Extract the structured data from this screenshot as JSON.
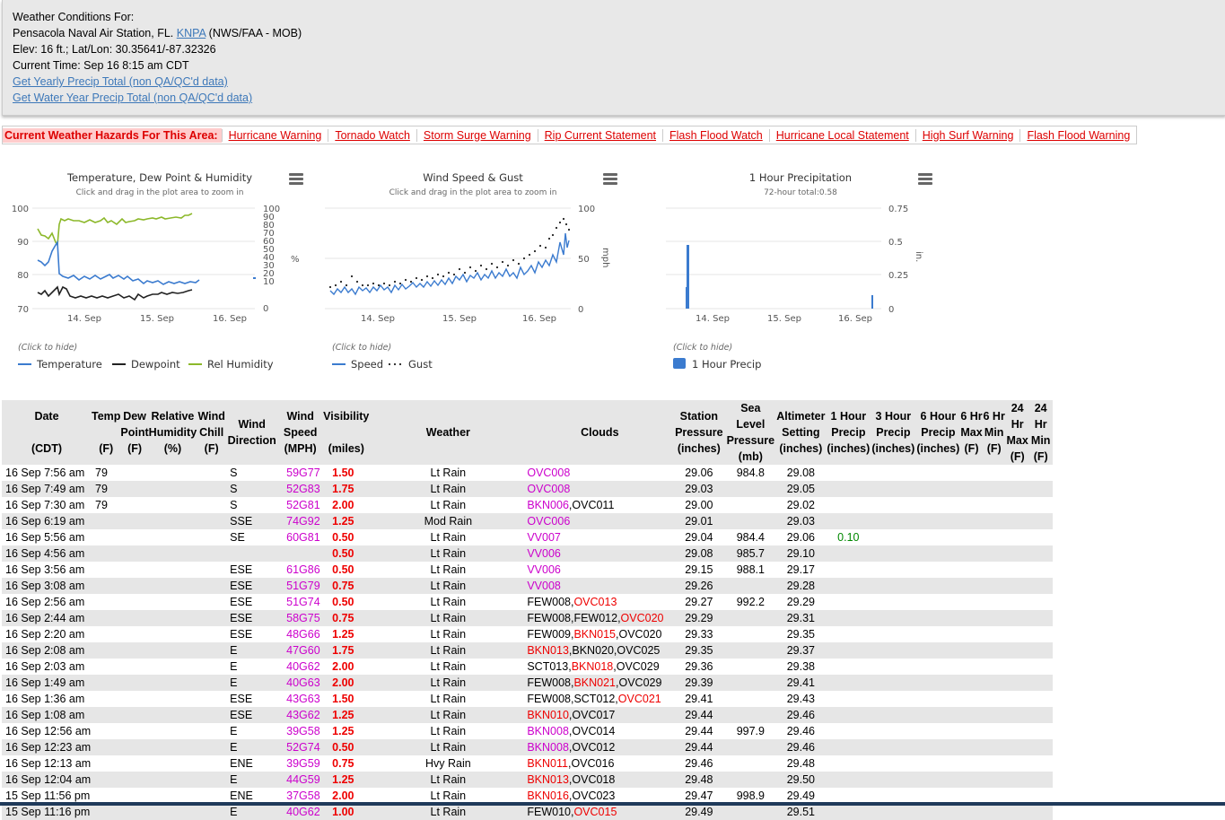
{
  "header": {
    "line1": "Weather Conditions For:",
    "station_prefix": "Pensacola Naval Air Station, FL.",
    "station_link": "KNPA",
    "station_suffix": "(NWS/FAA   - MOB)",
    "elev": "Elev: 16 ft.; Lat/Lon: 30.35641/-87.32326",
    "current_time": "Current Time: Sep 16 8:15 am CDT",
    "link_yearly": "Get Yearly Precip Total (non QA/QC'd data)",
    "link_water": "Get Water Year Precip Total (non QA/QC'd data)"
  },
  "hazards": {
    "label": "Current Weather Hazards For This Area:",
    "items": [
      "Hurricane Warning",
      "Tornado Watch",
      "Storm Surge Warning",
      "Rip Current Statement",
      "Flash Flood Watch",
      "Hurricane Local Statement",
      "High Surf Warning",
      "Flash Flood Warning"
    ]
  },
  "charts": {
    "temp": {
      "title": "Temperature, Dew Point & Humidity",
      "subtitle": "Click and drag in the plot area to zoom in",
      "hide": "(Click to hide)",
      "legend": [
        "Temperature",
        "Dewpoint",
        "Rel Humidity"
      ],
      "colors": [
        "#3b7bcf",
        "#222222",
        "#8cb82a"
      ],
      "yleft": [
        "100",
        "90",
        "80",
        "70"
      ],
      "yright": [
        "100",
        "90",
        "80",
        "70",
        "60",
        "50",
        "40",
        "30",
        "20",
        "10",
        "0"
      ],
      "yright_unit": "%",
      "xticks": [
        "14. Sep",
        "15. Sep",
        "16. Sep"
      ]
    },
    "wind": {
      "title": "Wind Speed & Gust",
      "subtitle": "Click and drag in the plot area to zoom in",
      "hide": "(Click to hide)",
      "legend": [
        "Speed",
        "Gust"
      ],
      "yright": [
        "100",
        "50",
        "0"
      ],
      "yunit": "mph",
      "xticks": [
        "14. Sep",
        "15. Sep",
        "16. Sep"
      ]
    },
    "precip": {
      "title": "1 Hour Precipitation",
      "subtitle": "72-hour total:0.58",
      "hide": "(Click to hide)",
      "legend": [
        "1 Hour Precip"
      ],
      "yright": [
        "0.75",
        "0.5",
        "0.25",
        "0"
      ],
      "yunit": "in.",
      "xticks": [
        "14. Sep",
        "15. Sep",
        "16. Sep"
      ]
    }
  },
  "table": {
    "headers": {
      "date": [
        "Date",
        "",
        "(CDT)"
      ],
      "temp": [
        "Temp",
        "",
        "(F)"
      ],
      "dew": [
        "Dew",
        "Point",
        "(F)"
      ],
      "rh": [
        "Relative",
        "Humidity",
        "(%)"
      ],
      "chill": [
        "Wind",
        "Chill",
        "(F)"
      ],
      "wdir": [
        "Wind",
        "Direction"
      ],
      "wspd": [
        "Wind",
        "Speed",
        "(MPH)"
      ],
      "vis": [
        "Visibility",
        "",
        "(miles)"
      ],
      "wx": [
        "Weather"
      ],
      "clouds": [
        "Clouds"
      ],
      "stp": [
        "Station",
        "Pressure",
        "(inches)"
      ],
      "slp": [
        "Sea Level",
        "Pressure",
        "(mb)"
      ],
      "alt": [
        "Altimeter",
        "Setting",
        "(inches)"
      ],
      "p1": [
        "1 Hour",
        "Precip",
        "(inches)"
      ],
      "p3": [
        "3 Hour",
        "Precip",
        "(inches)"
      ],
      "p6": [
        "6 Hour",
        "Precip",
        "(inches)"
      ],
      "max6": [
        "6 Hr",
        "Max",
        "(F)"
      ],
      "min6": [
        "6 Hr",
        "Min",
        "(F)"
      ],
      "max24": [
        "24 Hr",
        "Max",
        "(F)"
      ],
      "min24": [
        "24 Hr",
        "Min",
        "(F)"
      ]
    },
    "rows": [
      {
        "date": "16 Sep 7:56 am",
        "temp": "79",
        "dir": "S",
        "wind": "59G77",
        "vis": "1.50",
        "wx": "Lt Rain",
        "clouds": [
          [
            "OVC008",
            "m"
          ]
        ],
        "stp": "29.06",
        "slp": "984.8",
        "alt": "29.08",
        "p1": ""
      },
      {
        "date": "16 Sep 7:49 am",
        "temp": "79",
        "dir": "S",
        "wind": "52G83",
        "vis": "1.75",
        "wx": "Lt Rain",
        "clouds": [
          [
            "OVC008",
            "m"
          ]
        ],
        "stp": "29.03",
        "slp": "",
        "alt": "29.05",
        "p1": ""
      },
      {
        "date": "16 Sep 7:30 am",
        "temp": "79",
        "dir": "S",
        "wind": "52G81",
        "vis": "2.00",
        "wx": "Lt Rain",
        "clouds": [
          [
            "BKN006",
            "m"
          ],
          [
            ",OVC011",
            "k"
          ]
        ],
        "stp": "29.00",
        "slp": "",
        "alt": "29.02",
        "p1": ""
      },
      {
        "date": "16 Sep 6:19 am",
        "temp": "",
        "dir": "SSE",
        "wind": "74G92",
        "vis": "1.25",
        "wx": "Mod Rain",
        "clouds": [
          [
            "OVC006",
            "m"
          ]
        ],
        "stp": "29.01",
        "slp": "",
        "alt": "29.03",
        "p1": ""
      },
      {
        "date": "16 Sep 5:56 am",
        "temp": "",
        "dir": "SE",
        "wind": "60G81",
        "vis": "0.50",
        "wx": "Lt Rain",
        "clouds": [
          [
            "VV007",
            "m"
          ]
        ],
        "stp": "29.04",
        "slp": "984.4",
        "alt": "29.06",
        "p1": "0.10"
      },
      {
        "date": "16 Sep 4:56 am",
        "temp": "",
        "dir": "",
        "wind": "",
        "vis": "0.50",
        "wx": "Lt Rain",
        "clouds": [
          [
            "VV006",
            "m"
          ]
        ],
        "stp": "29.08",
        "slp": "985.7",
        "alt": "29.10",
        "p1": ""
      },
      {
        "date": "16 Sep 3:56 am",
        "temp": "",
        "dir": "ESE",
        "wind": "61G86",
        "vis": "0.50",
        "wx": "Lt Rain",
        "clouds": [
          [
            "VV006",
            "m"
          ]
        ],
        "stp": "29.15",
        "slp": "988.1",
        "alt": "29.17",
        "p1": ""
      },
      {
        "date": "16 Sep 3:08 am",
        "temp": "",
        "dir": "ESE",
        "wind": "51G79",
        "vis": "0.75",
        "wx": "Lt Rain",
        "clouds": [
          [
            "VV008",
            "m"
          ]
        ],
        "stp": "29.26",
        "slp": "",
        "alt": "29.28",
        "p1": ""
      },
      {
        "date": "16 Sep 2:56 am",
        "temp": "",
        "dir": "ESE",
        "wind": "51G74",
        "vis": "0.50",
        "wx": "Lt Rain",
        "clouds": [
          [
            "FEW008,",
            "k"
          ],
          [
            "OVC013",
            "r"
          ]
        ],
        "stp": "29.27",
        "slp": "992.2",
        "alt": "29.29",
        "p1": ""
      },
      {
        "date": "16 Sep 2:44 am",
        "temp": "",
        "dir": "ESE",
        "wind": "58G75",
        "vis": "0.75",
        "wx": "Lt Rain",
        "clouds": [
          [
            "FEW008,FEW012,",
            "k"
          ],
          [
            "OVC020",
            "r"
          ]
        ],
        "stp": "29.29",
        "slp": "",
        "alt": "29.31",
        "p1": ""
      },
      {
        "date": "16 Sep 2:20 am",
        "temp": "",
        "dir": "ESE",
        "wind": "48G66",
        "vis": "1.25",
        "wx": "Lt Rain",
        "clouds": [
          [
            "FEW009,",
            "k"
          ],
          [
            "BKN015",
            "r"
          ],
          [
            ",OVC020",
            "k"
          ]
        ],
        "stp": "29.33",
        "slp": "",
        "alt": "29.35",
        "p1": ""
      },
      {
        "date": "16 Sep 2:08 am",
        "temp": "",
        "dir": "E",
        "wind": "47G60",
        "vis": "1.75",
        "wx": "Lt Rain",
        "clouds": [
          [
            "BKN013",
            "r"
          ],
          [
            ",BKN020,OVC025",
            "k"
          ]
        ],
        "stp": "29.35",
        "slp": "",
        "alt": "29.37",
        "p1": ""
      },
      {
        "date": "16 Sep 2:03 am",
        "temp": "",
        "dir": "E",
        "wind": "40G62",
        "vis": "2.00",
        "wx": "Lt Rain",
        "clouds": [
          [
            "SCT013,",
            "k"
          ],
          [
            "BKN018",
            "r"
          ],
          [
            ",OVC029",
            "k"
          ]
        ],
        "stp": "29.36",
        "slp": "",
        "alt": "29.38",
        "p1": ""
      },
      {
        "date": "16 Sep 1:49 am",
        "temp": "",
        "dir": "E",
        "wind": "40G63",
        "vis": "2.00",
        "wx": "Lt Rain",
        "clouds": [
          [
            "FEW008,",
            "k"
          ],
          [
            "BKN021",
            "r"
          ],
          [
            ",OVC029",
            "k"
          ]
        ],
        "stp": "29.39",
        "slp": "",
        "alt": "29.41",
        "p1": ""
      },
      {
        "date": "16 Sep 1:36 am",
        "temp": "",
        "dir": "ESE",
        "wind": "43G63",
        "vis": "1.50",
        "wx": "Lt Rain",
        "clouds": [
          [
            "FEW008,SCT012,",
            "k"
          ],
          [
            "OVC021",
            "r"
          ]
        ],
        "stp": "29.41",
        "slp": "",
        "alt": "29.43",
        "p1": ""
      },
      {
        "date": "16 Sep 1:08 am",
        "temp": "",
        "dir": "ESE",
        "wind": "43G62",
        "vis": "1.25",
        "wx": "Lt Rain",
        "clouds": [
          [
            "BKN010",
            "r"
          ],
          [
            ",OVC017",
            "k"
          ]
        ],
        "stp": "29.44",
        "slp": "",
        "alt": "29.46",
        "p1": ""
      },
      {
        "date": "16 Sep 12:56 am",
        "temp": "",
        "dir": "E",
        "wind": "39G58",
        "vis": "1.25",
        "wx": "Lt Rain",
        "clouds": [
          [
            "BKN008",
            "m"
          ],
          [
            ",OVC014",
            "k"
          ]
        ],
        "stp": "29.44",
        "slp": "997.9",
        "alt": "29.46",
        "p1": ""
      },
      {
        "date": "16 Sep 12:23 am",
        "temp": "",
        "dir": "E",
        "wind": "52G74",
        "vis": "0.50",
        "wx": "Lt Rain",
        "clouds": [
          [
            "BKN008",
            "m"
          ],
          [
            ",OVC012",
            "k"
          ]
        ],
        "stp": "29.44",
        "slp": "",
        "alt": "29.46",
        "p1": ""
      },
      {
        "date": "16 Sep 12:13 am",
        "temp": "",
        "dir": "ENE",
        "wind": "39G59",
        "vis": "0.75",
        "wx": "Hvy Rain",
        "clouds": [
          [
            "BKN011",
            "r"
          ],
          [
            ",OVC016",
            "k"
          ]
        ],
        "stp": "29.46",
        "slp": "",
        "alt": "29.48",
        "p1": ""
      },
      {
        "date": "16 Sep 12:04 am",
        "temp": "",
        "dir": "E",
        "wind": "44G59",
        "vis": "1.25",
        "wx": "Lt Rain",
        "clouds": [
          [
            "BKN013",
            "r"
          ],
          [
            ",OVC018",
            "k"
          ]
        ],
        "stp": "29.48",
        "slp": "",
        "alt": "29.50",
        "p1": ""
      },
      {
        "date": "15 Sep 11:56 pm",
        "temp": "",
        "dir": "ENE",
        "wind": "37G58",
        "vis": "2.00",
        "wx": "Lt Rain",
        "clouds": [
          [
            "BKN016",
            "r"
          ],
          [
            ",OVC023",
            "k"
          ]
        ],
        "stp": "29.47",
        "slp": "998.9",
        "alt": "29.49",
        "p1": ""
      },
      {
        "date": "15 Sep 11:16 pm",
        "temp": "",
        "dir": "E",
        "wind": "40G62",
        "vis": "1.00",
        "wx": "Lt Rain",
        "clouds": [
          [
            "FEW010,",
            "k"
          ],
          [
            "OVC015",
            "r"
          ]
        ],
        "stp": "29.49",
        "slp": "",
        "alt": "29.51",
        "p1": ""
      }
    ]
  }
}
